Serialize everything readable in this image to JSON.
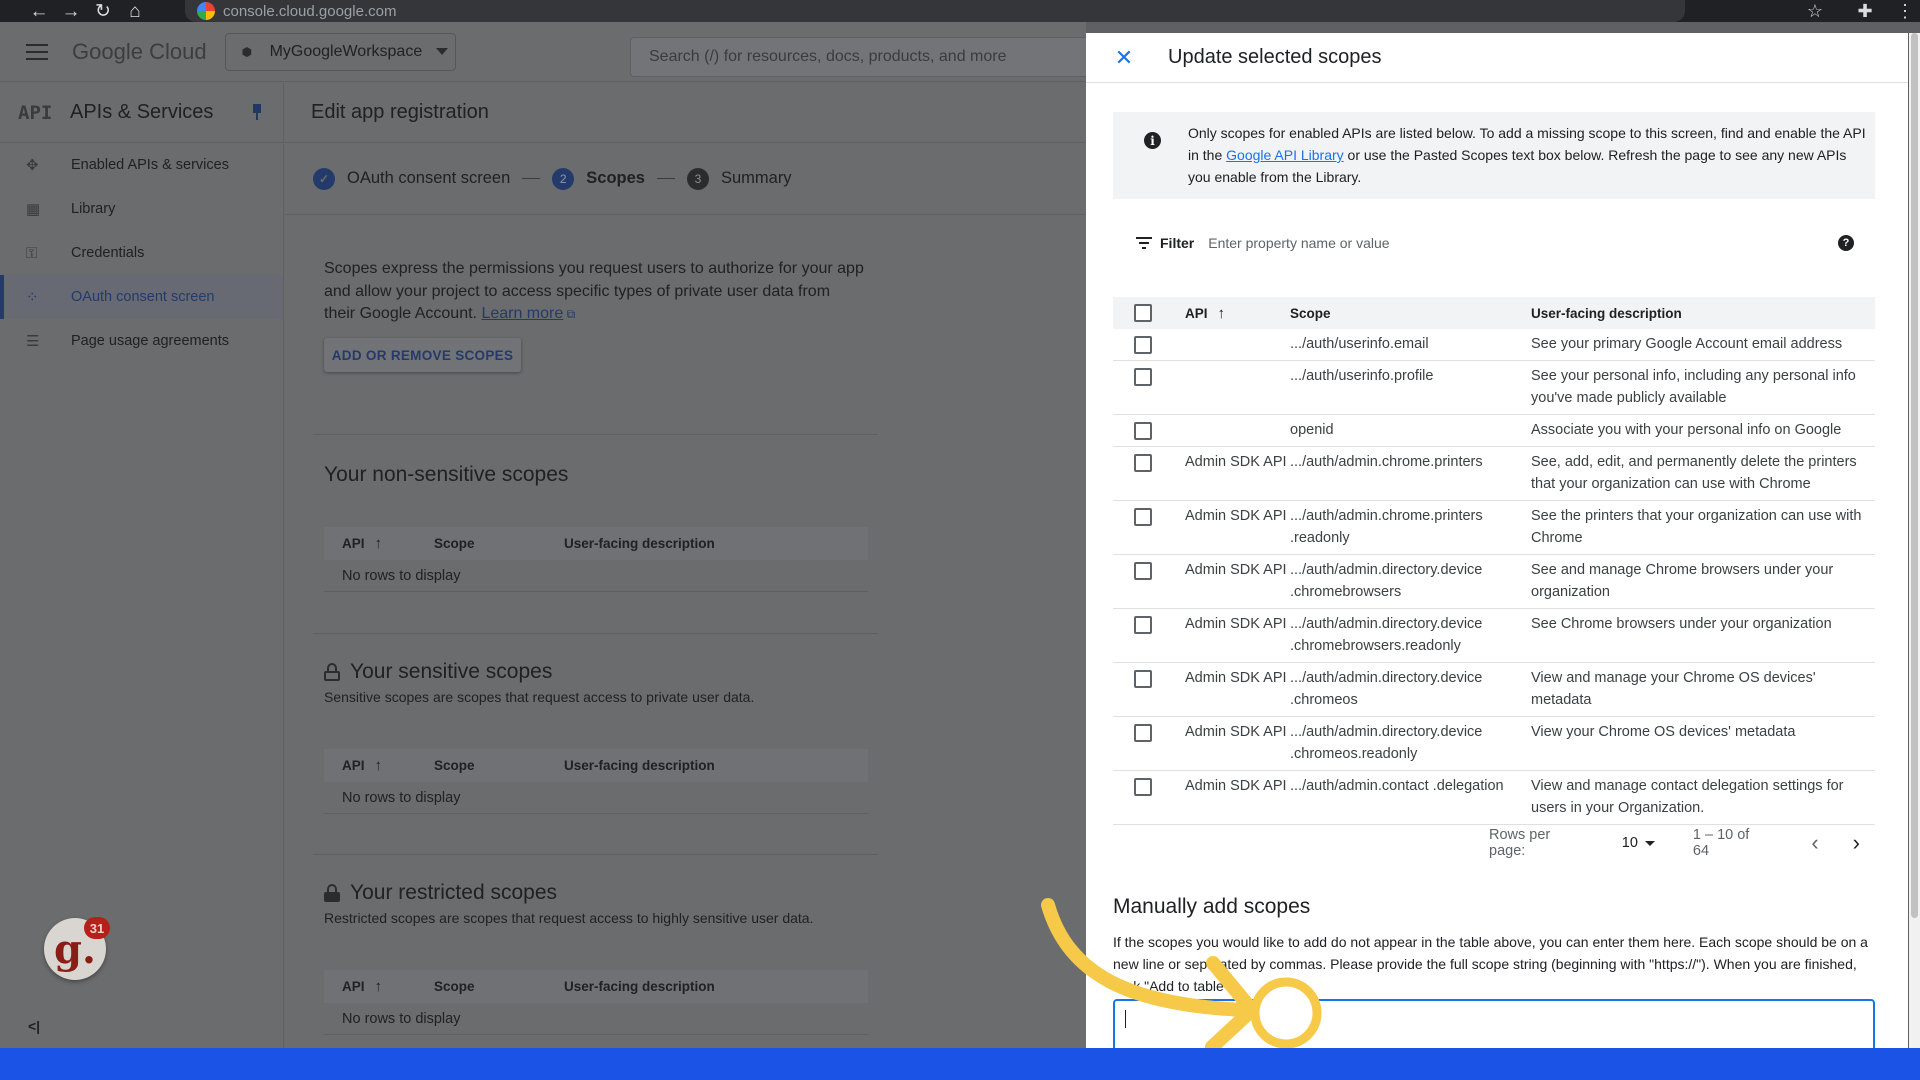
{
  "browser": {
    "url": "console.cloud.google.com",
    "nav_icons": [
      "back-icon",
      "forward-icon",
      "reload-icon",
      "home-icon"
    ],
    "right_icons": [
      "star-icon",
      "extensions-icon",
      "more-icon"
    ]
  },
  "header": {
    "logo_google": "Google",
    "logo_cloud": "Cloud",
    "project": "MyGoogleWorkspace",
    "search_placeholder": "Search (/) for resources, docs, products, and more"
  },
  "sidebar": {
    "logo": "API",
    "title": "APIs & Services",
    "items": [
      {
        "label": "Enabled APIs & services",
        "icon": "api-services-icon"
      },
      {
        "label": "Library",
        "icon": "library-icon"
      },
      {
        "label": "Credentials",
        "icon": "key-icon"
      },
      {
        "label": "OAuth consent screen",
        "icon": "consent-icon",
        "active": true
      },
      {
        "label": "Page usage agreements",
        "icon": "agreements-icon"
      }
    ]
  },
  "main": {
    "title": "Edit app registration",
    "steps": [
      {
        "label": "OAuth consent screen",
        "state": "done"
      },
      {
        "number": "2",
        "label": "Scopes",
        "state": "current"
      },
      {
        "number": "3",
        "label": "Summary",
        "state": "pending"
      }
    ],
    "intro": "Scopes express the permissions you request users to authorize for your app and allow your project to access specific types of private user data from their Google Account.",
    "learn_more": "Learn more",
    "add_remove_button": "ADD OR REMOVE SCOPES",
    "non_sensitive_title": "Your non-sensitive scopes",
    "sensitive_title": "Your sensitive scopes",
    "sensitive_desc": "Sensitive scopes are scopes that request access to private user data.",
    "restricted_title": "Your restricted scopes",
    "restricted_desc": "Restricted scopes are scopes that request access to highly sensitive user data.",
    "table_cols": {
      "api": "API",
      "scope": "Scope",
      "desc": "User-facing description"
    },
    "no_rows": "No rows to display"
  },
  "extension": {
    "letter": "g.",
    "badge": "31"
  },
  "panel": {
    "title": "Update selected scopes",
    "info_before": "Only scopes for enabled APIs are listed below. To add a missing scope to this screen, find and enable the API in the ",
    "info_link": "Google API Library",
    "info_after": " or use the Pasted Scopes text box below. Refresh the page to see any new APIs you enable from the Library.",
    "filter_label": "Filter",
    "filter_placeholder": "Enter property name or value",
    "cols": {
      "api": "API",
      "scope": "Scope",
      "desc": "User-facing description"
    },
    "rows": [
      {
        "api": "",
        "scope": ".../auth/userinfo.email",
        "desc": "See your primary Google Account email address"
      },
      {
        "api": "",
        "scope": ".../auth/userinfo.profile",
        "desc": "See your personal info, including any personal info you've made publicly available"
      },
      {
        "api": "",
        "scope": "openid",
        "desc": "Associate you with your personal info on Google"
      },
      {
        "api": "Admin SDK API",
        "scope": ".../auth/admin.chrome.printers",
        "desc": "See, add, edit, and permanently delete the printers that your organization can use with Chrome"
      },
      {
        "api": "Admin SDK API",
        "scope": ".../auth/admin.chrome.printers .readonly",
        "desc": "See the printers that your organization can use with Chrome"
      },
      {
        "api": "Admin SDK API",
        "scope": ".../auth/admin.directory.device .chromebrowsers",
        "desc": "See and manage Chrome browsers under your organization"
      },
      {
        "api": "Admin SDK API",
        "scope": ".../auth/admin.directory.device .chromebrowsers.readonly",
        "desc": "See Chrome browsers under your organization"
      },
      {
        "api": "Admin SDK API",
        "scope": ".../auth/admin.directory.device .chromeos",
        "desc": "View and manage your Chrome OS devices' metadata"
      },
      {
        "api": "Admin SDK API",
        "scope": ".../auth/admin.directory.device .chromeos.readonly",
        "desc": "View your Chrome OS devices' metadata"
      },
      {
        "api": "Admin SDK API",
        "scope": ".../auth/admin.contact .delegation",
        "desc": "View and manage contact delegation settings for users in your Organization."
      }
    ],
    "rows_per_page_label": "Rows per page:",
    "rows_per_page": "10",
    "range": "1 – 10 of 64",
    "manual_title": "Manually add scopes",
    "manual_desc": "If the scopes you would like to add do not appear in the table above, you can enter them here. Each scope should be on a new line or separated by commas. Please provide the full scope string (beginning with \"https://\"). When you are finished, click \"Add to table\"."
  },
  "colors": {
    "accent": "#1a73e8",
    "annotation": "#f7c948",
    "bottom_band": "#1a53e6"
  }
}
